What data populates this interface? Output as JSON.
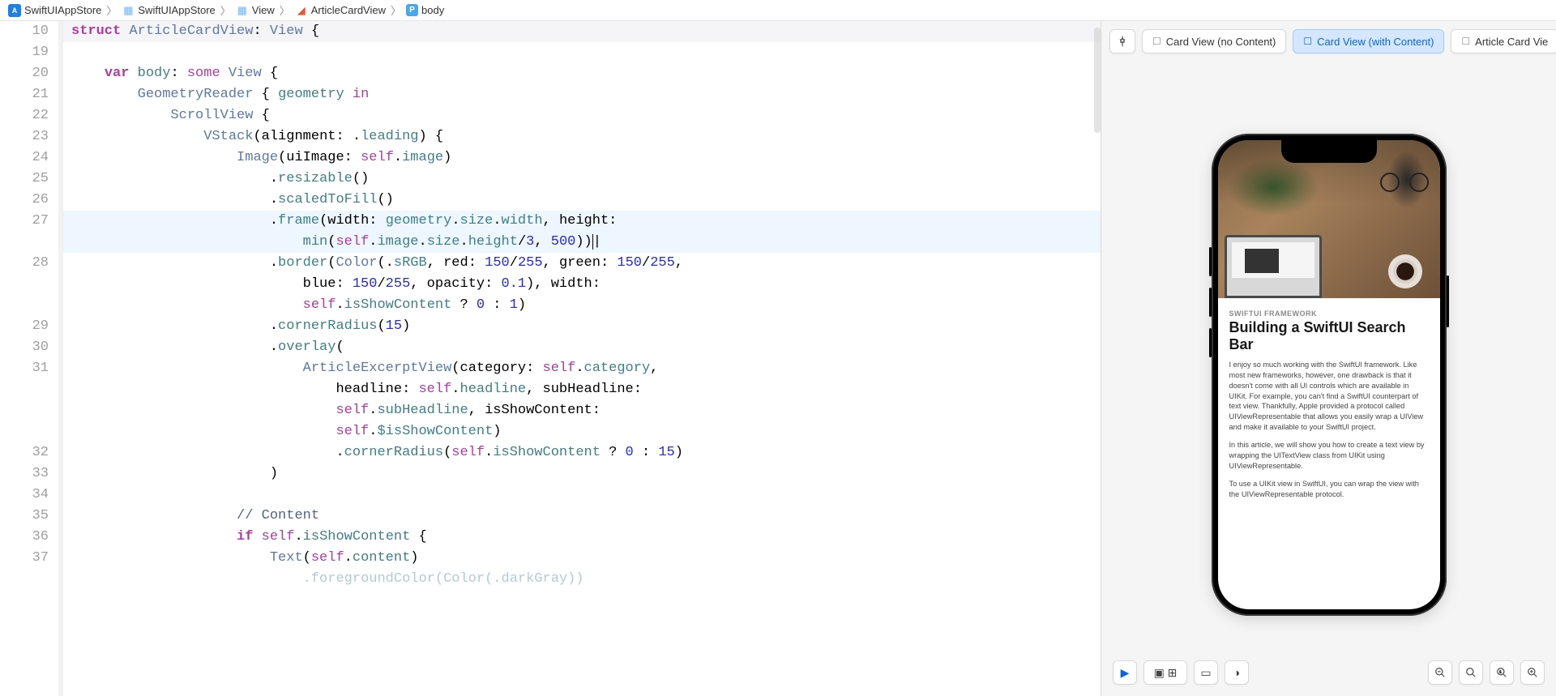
{
  "breadcrumb": {
    "project": "SwiftUIAppStore",
    "target": "SwiftUIAppStore",
    "folder": "View",
    "file": "ArticleCardView",
    "symbol": "body"
  },
  "code": {
    "lines": [
      {
        "n": "10",
        "cls": "decl",
        "html": "<span class='kw'>struct</span> <span class='ty'>ArticleCardView</span>: <span class='ty'>View</span> {"
      },
      {
        "n": "19",
        "cls": "",
        "html": ""
      },
      {
        "n": "20",
        "cls": "",
        "html": "    <span class='kw'>var</span> <span class='var'>body</span>: <span class='kw2'>some</span> <span class='ty'>View</span> {"
      },
      {
        "n": "21",
        "cls": "",
        "html": "        <span class='ty'>GeometryReader</span> { <span class='se'>geometry</span> <span class='kw2'>in</span>"
      },
      {
        "n": "22",
        "cls": "",
        "html": "            <span class='ty'>ScrollView</span> {"
      },
      {
        "n": "23",
        "cls": "",
        "html": "                <span class='ty'>VStack</span>(alignment: .<span class='se'>leading</span>) {"
      },
      {
        "n": "24",
        "cls": "",
        "html": "                    <span class='ty'>Image</span>(uiImage: <span class='kw2'>self</span>.<span class='se'>image</span>)"
      },
      {
        "n": "25",
        "cls": "",
        "html": "                        .<span class='se'>resizable</span>()"
      },
      {
        "n": "26",
        "cls": "",
        "html": "                        .<span class='se'>scaledToFill</span>()"
      },
      {
        "n": "27",
        "cls": "hl",
        "html": "                        .<span class='se'>frame</span>(width: <span class='se'>geometry</span>.<span class='se'>size</span>.<span class='se'>width</span>, height:"
      },
      {
        "n": "",
        "cls": "hl",
        "html": "                            <span class='se'>min</span>(<span class='kw2'>self</span>.<span class='se'>image</span>.<span class='se'>size</span>.<span class='se'>height</span>/<span class='num'>3</span>, <span class='num'>500</span>))<span style='border-left:1px solid #000'>|</span>"
      },
      {
        "n": "28",
        "cls": "",
        "html": "                        .<span class='se'>border</span>(<span class='ty'>Color</span>(.<span class='se'>sRGB</span>, red: <span class='num'>150</span>/<span class='num'>255</span>, green: <span class='num'>150</span>/<span class='num'>255</span>,"
      },
      {
        "n": "",
        "cls": "",
        "html": "                            blue: <span class='num'>150</span>/<span class='num'>255</span>, opacity: <span class='num'>0.1</span>), width:"
      },
      {
        "n": "",
        "cls": "",
        "html": "                            <span class='kw2'>self</span>.<span class='se'>isShowContent</span> ? <span class='num'>0</span> : <span class='num'>1</span>)"
      },
      {
        "n": "29",
        "cls": "",
        "html": "                        .<span class='se'>cornerRadius</span>(<span class='num'>15</span>)"
      },
      {
        "n": "30",
        "cls": "",
        "html": "                        .<span class='se'>overlay</span>("
      },
      {
        "n": "31",
        "cls": "",
        "html": "                            <span class='ty'>ArticleExcerptView</span>(category: <span class='kw2'>self</span>.<span class='se'>category</span>,"
      },
      {
        "n": "",
        "cls": "",
        "html": "                                headline: <span class='kw2'>self</span>.<span class='se'>headline</span>, subHeadline:"
      },
      {
        "n": "",
        "cls": "",
        "html": "                                <span class='kw2'>self</span>.<span class='se'>subHeadline</span>, isShowContent:"
      },
      {
        "n": "",
        "cls": "",
        "html": "                                <span class='kw2'>self</span>.<span class='se'>$isShowContent</span>)"
      },
      {
        "n": "32",
        "cls": "",
        "html": "                                .<span class='se'>cornerRadius</span>(<span class='kw2'>self</span>.<span class='se'>isShowContent</span> ? <span class='num'>0</span> : <span class='num'>15</span>)"
      },
      {
        "n": "33",
        "cls": "",
        "html": "                        )"
      },
      {
        "n": "34",
        "cls": "",
        "html": ""
      },
      {
        "n": "35",
        "cls": "",
        "html": "                    <span class='cmt'>// Content</span>"
      },
      {
        "n": "36",
        "cls": "",
        "html": "                    <span class='kw'>if</span> <span class='kw2'>self</span>.<span class='se'>isShowContent</span> {"
      },
      {
        "n": "37",
        "cls": "",
        "html": "                        <span class='ty'>Text</span>(<span class='kw2'>self</span>.<span class='se'>content</span>)"
      },
      {
        "n": "",
        "cls": "",
        "html": "                            <span class='se' style='opacity:.4'>.foregroundColor(Color(.darkGray))</span>"
      }
    ]
  },
  "preview": {
    "pill1": "Card View (no Content)",
    "pill2": "Card View (with Content)",
    "pill3": "Article Card Vie",
    "category": "SWIFTUI FRAMEWORK",
    "headline": "Building a SwiftUI Search Bar",
    "p1": "I enjoy so much working with the SwiftUI framework. Like most new frameworks, however, one drawback is that it doesn't come with all UI controls which are available in UIKit. For example, you can't find a SwiftUI counterpart of text view. Thankfully, Apple provided a protocol called UIViewRepresentable that allows you easily wrap a UIView and make it available to your SwiftUI project.",
    "p2": "In this article, we will show you how to create a text view by wrapping the UITextView class from UIKit using UIViewRepresentable.",
    "p3": "To use a UIKit view in SwiftUI, you can wrap the view with the UIViewRepresentable protocol."
  }
}
